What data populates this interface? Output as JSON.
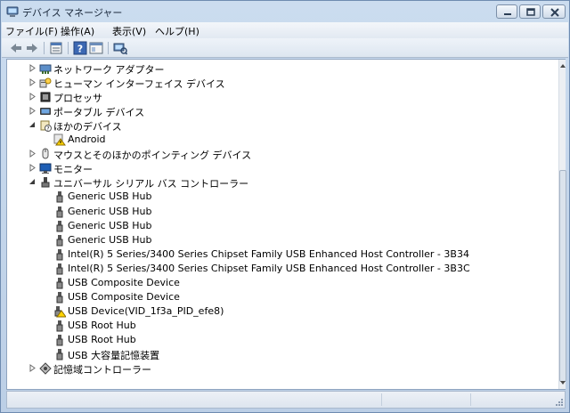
{
  "window": {
    "title": "デバイス マネージャー"
  },
  "menu": [
    {
      "label": "ファイル(F)"
    },
    {
      "label": "操作(A)"
    },
    {
      "label": "表示(V)"
    },
    {
      "label": "ヘルプ(H)"
    }
  ],
  "toolbar": {
    "buttons": [
      "back-icon",
      "forward-icon",
      "properties-icon",
      "help-icon",
      "view-icon",
      "scan-hardware-icon"
    ]
  },
  "tree": [
    {
      "label": "ネットワーク アダプター",
      "expanded": false,
      "icon": "network-adapter-icon",
      "level": 1
    },
    {
      "label": "ヒューマン インターフェイス デバイス",
      "expanded": false,
      "icon": "hid-icon",
      "level": 1
    },
    {
      "label": "プロセッサ",
      "expanded": false,
      "icon": "processor-icon",
      "level": 1
    },
    {
      "label": "ポータブル デバイス",
      "expanded": false,
      "icon": "portable-device-icon",
      "level": 1
    },
    {
      "label": "ほかのデバイス",
      "expanded": true,
      "icon": "other-devices-icon",
      "level": 1
    },
    {
      "label": "Android",
      "icon": "warning-device-icon",
      "level": 2
    },
    {
      "label": "マウスとそのほかのポインティング デバイス",
      "expanded": false,
      "icon": "mouse-icon",
      "level": 1
    },
    {
      "label": "モニター",
      "expanded": false,
      "icon": "monitor-icon",
      "level": 1
    },
    {
      "label": "ユニバーサル シリアル バス コントローラー",
      "expanded": true,
      "icon": "usb-controller-icon",
      "level": 1
    },
    {
      "label": "Generic USB Hub",
      "icon": "usb-plug-icon",
      "level": 2
    },
    {
      "label": "Generic USB Hub",
      "icon": "usb-plug-icon",
      "level": 2
    },
    {
      "label": "Generic USB Hub",
      "icon": "usb-plug-icon",
      "level": 2
    },
    {
      "label": "Generic USB Hub",
      "icon": "usb-plug-icon",
      "level": 2
    },
    {
      "label": "Intel(R) 5 Series/3400 Series Chipset Family USB Enhanced Host Controller - 3B34",
      "icon": "usb-plug-icon",
      "level": 2
    },
    {
      "label": "Intel(R) 5 Series/3400 Series Chipset Family USB Enhanced Host Controller - 3B3C",
      "icon": "usb-plug-icon",
      "level": 2
    },
    {
      "label": "USB Composite Device",
      "icon": "usb-plug-icon",
      "level": 2
    },
    {
      "label": "USB Composite Device",
      "icon": "usb-plug-icon",
      "level": 2
    },
    {
      "label": "USB Device(VID_1f3a_PID_efe8)",
      "icon": "usb-warning-icon",
      "level": 2
    },
    {
      "label": "USB Root Hub",
      "icon": "usb-plug-icon",
      "level": 2
    },
    {
      "label": "USB Root Hub",
      "icon": "usb-plug-icon",
      "level": 2
    },
    {
      "label": "USB 大容量記憶装置",
      "icon": "usb-plug-icon",
      "level": 2
    },
    {
      "label": "記憶域コントローラー",
      "expanded": false,
      "icon": "storage-controller-icon",
      "level": 1
    }
  ]
}
